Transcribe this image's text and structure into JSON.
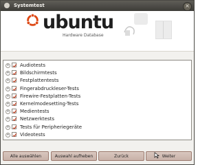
{
  "window": {
    "title": "Systemtest",
    "close_symbol": "×"
  },
  "banner": {
    "logo_text": "ubuntu",
    "subtitle": "Hardware Database"
  },
  "tests": [
    {
      "label": "Audiotests",
      "checked": true
    },
    {
      "label": "Bildschirmtests",
      "checked": true
    },
    {
      "label": "Festplattentests",
      "checked": true
    },
    {
      "label": "Fingerabdruckleser-Tests",
      "checked": true
    },
    {
      "label": "Firewire-Festplatten-Tests",
      "checked": true
    },
    {
      "label": "Kernelmodesetting-Tests",
      "checked": true
    },
    {
      "label": "Medientests",
      "checked": true
    },
    {
      "label": "Netzwerktests",
      "checked": true
    },
    {
      "label": "Tests für Peripheriegeräte",
      "checked": true
    },
    {
      "label": "Videotests",
      "checked": true
    }
  ],
  "buttons": {
    "select_all": "Alle auswählen",
    "deselect_all": "Auswahl aufheben",
    "back": "Zurück",
    "next": "Weiter"
  },
  "colors": {
    "checkbox_checkmark": "#c44b2f",
    "ubuntu_orange": "#dd4814"
  }
}
